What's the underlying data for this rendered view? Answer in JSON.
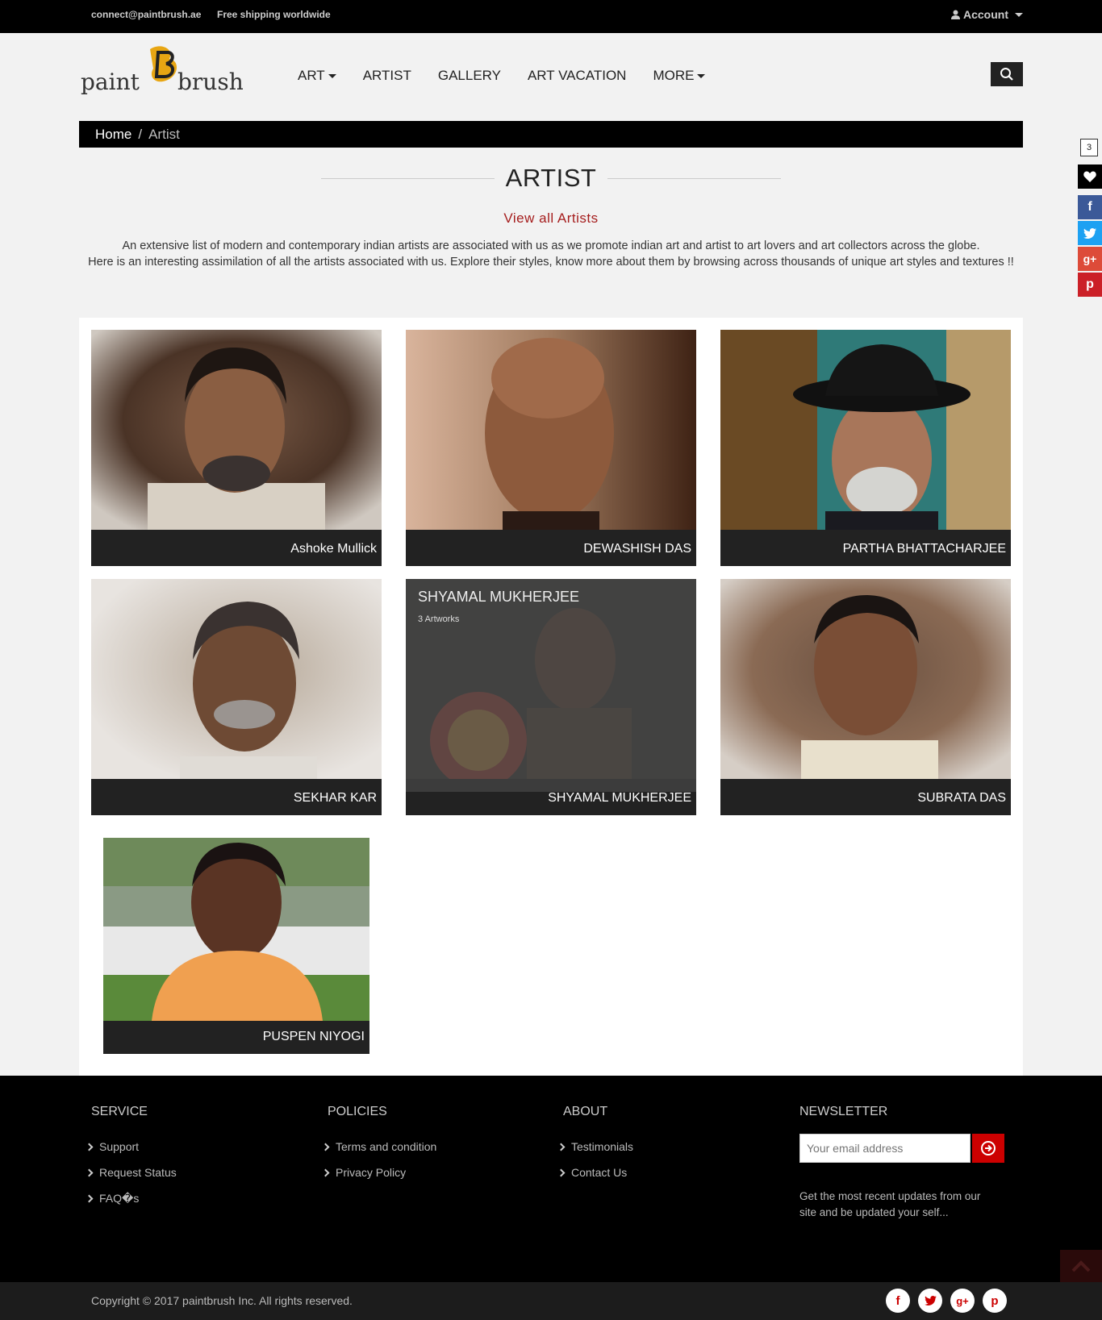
{
  "topbar": {
    "email": "connect@paintbrush.ae",
    "shipping": "Free shipping worldwide",
    "account_label": "Account"
  },
  "header": {
    "logo_text_left": "paint",
    "logo_mark": "B",
    "logo_text_right": "brush",
    "nav": [
      {
        "label": "ART",
        "has_caret": true
      },
      {
        "label": "ARTIST",
        "has_caret": false
      },
      {
        "label": "GALLERY",
        "has_caret": false
      },
      {
        "label": "ART VACATION",
        "has_caret": false
      },
      {
        "label": "MORE",
        "has_caret": true
      }
    ],
    "search_icon": "search-icon"
  },
  "breadcrumb": {
    "home": "Home",
    "separator": "/",
    "current": "Artist"
  },
  "page": {
    "title": "ARTIST",
    "view_all": "View all Artists",
    "description_line1": "An extensive list of modern and contemporary indian artists are associated with us as we promote indian art and artist to art lovers and art collectors across the globe.",
    "description_line2": "Here is an interesting assimilation of all the artists associated with us. Explore their styles, know more about them by browsing across thousands of unique art styles and textures !!"
  },
  "side_social": {
    "wishlist_count": "3",
    "icons": [
      "heart-icon",
      "facebook-icon",
      "twitter-icon",
      "google-plus-icon",
      "pinterest-icon"
    ]
  },
  "artists": [
    {
      "name": "Ashoke Mullick"
    },
    {
      "name": "DEWASHISH DAS"
    },
    {
      "name": "PARTHA BHATTACHARJEE"
    },
    {
      "name": "SEKHAR KAR"
    },
    {
      "name": "SHYAMAL MUKHERJEE",
      "hover_name": "SHYAMAL MUKHERJEE",
      "hover_count": "3 Artworks"
    },
    {
      "name": "SUBRATA DAS"
    },
    {
      "name": "PUSPEN NIYOGI"
    }
  ],
  "footer": {
    "service": {
      "title": "SERVICE",
      "links": [
        "Support",
        "Request Status",
        "FAQ�s"
      ]
    },
    "policies": {
      "title": "POLICIES",
      "links": [
        "Terms and condition",
        "Privacy Policy"
      ]
    },
    "about": {
      "title": "ABOUT",
      "links": [
        "Testimonials",
        "Contact Us"
      ]
    },
    "newsletter": {
      "title": "NEWSLETTER",
      "placeholder": "Your email address",
      "note": "Get the most recent updates from our site and be updated your self..."
    },
    "copyright": "Copyright © 2017 paintbrush Inc. All rights reserved.",
    "social_icons": [
      "facebook-icon",
      "twitter-icon",
      "google-plus-icon",
      "pinterest-icon"
    ]
  },
  "colors": {
    "accent_red": "#a51d1d",
    "facebook": "#3b5998",
    "twitter": "#1da1f2",
    "google_plus": "#dd4b39",
    "pinterest": "#cb2027"
  }
}
